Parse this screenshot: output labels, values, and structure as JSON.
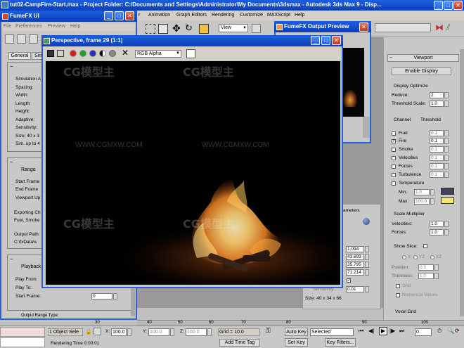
{
  "main_window": {
    "title": "tut02-CampFire-Start.max    - Project Folder: C:\\Documents and Settings\\Administrator\\My Documents\\3dsmax    - Autodesk 3ds Max 9    - Disp...",
    "menu": [
      "r",
      "Animation",
      "Graph Editors",
      "Rendering",
      "Customize",
      "MAXScript",
      "Help"
    ],
    "view_dropdown": "View"
  },
  "fumefx_ui": {
    "title": "FumeFX UI",
    "menu": [
      "File",
      "Preferences",
      "Preview",
      "Help"
    ],
    "tabs": [
      "General",
      "Sim"
    ],
    "sim_labels": [
      "Simulation A",
      "Spacing:",
      "Width:",
      "Length:",
      "Height:",
      "Adaptive:",
      "Sensitivity:",
      "Size: 40 x 3",
      "Sim. up to 4"
    ],
    "range_title": "Range",
    "range_labels": [
      "Start Frame",
      "End Frame",
      "Viewport Up"
    ],
    "exporting": [
      "Exporting Ch",
      "Fuel, Smoke"
    ],
    "output_label": "Output Path:",
    "output_path": "C:\\fxData\\s",
    "playback_title": "Playback",
    "playback_labels": [
      "Play From:",
      "Play To:",
      "Start Frame:"
    ],
    "start_frame_value": "0",
    "bottom_cut": "Output Range Type:"
  },
  "output_preview": {
    "title": "FumeFX Output Preview"
  },
  "render_window": {
    "title": "Perspective, frame 29 (1:1)",
    "channel_dropdown": "RGB Alpha",
    "watermark_text": "模型主",
    "watermark_logo": "CG",
    "watermark_url": "WWW.CGMXW.COM"
  },
  "middle_panel": {
    "params_label": "ameters",
    "values": [
      "1.094",
      "43.693",
      "35.795",
      "71.214"
    ],
    "sensitivity_label": "Sensitivity:",
    "sensitivity_value": "0.01",
    "size_label": "Size: 40 x 34 x 66"
  },
  "viewport_panel": {
    "title": "Viewport",
    "enable_display": "Enable Display",
    "display_optimize": "Display Optimize",
    "reduce_label": "Reduce:",
    "reduce_value": "2",
    "threshold_scale_label": "Threshold Scale:",
    "threshold_scale_value": "1.0",
    "channel_header": "Channel",
    "threshold_header": "Threshold",
    "channels": [
      {
        "name": "Fuel",
        "checked": false,
        "value": "0.1"
      },
      {
        "name": "Fire",
        "checked": true,
        "value": "0.1"
      },
      {
        "name": "Smoke",
        "checked": false,
        "value": "0.1"
      },
      {
        "name": "Velocities",
        "checked": false,
        "value": "0.1"
      },
      {
        "name": "Forces",
        "checked": false,
        "value": "0.1"
      },
      {
        "name": "Turbulence",
        "checked": false,
        "value": "0.1"
      },
      {
        "name": "Temperature",
        "checked": false,
        "value": ""
      }
    ],
    "min_label": "Min:",
    "min_value": "1.0",
    "max_label": "Max:",
    "max_value": "100.0",
    "min_color": "#4a3d5a",
    "max_color": "#f4e27a",
    "scale_multiplier": "Scale Multiplier",
    "velocities_label": "Velocities:",
    "velocities_value": "1.0",
    "forces_label": "Forces:",
    "forces_value": "1.0",
    "show_slice_label": "Show Slice:",
    "axis_options": [
      "X",
      "YZ",
      "XZ"
    ],
    "position_label": "Position:",
    "position_value": "0.0",
    "thickness_label": "Thickness:",
    "thickness_value": "1.0",
    "grid_label": "Grid",
    "numerical_values_label": "Numerical Values",
    "voxel_grid_label": "Voxel Grid"
  },
  "status_bar": {
    "object_selected": "1 Object Sele",
    "rendering_time": "Rendering Time  0:00:01",
    "x_label": "X:",
    "x_value": "100.0",
    "y_label": "Y:",
    "y_value": "100.0",
    "z_label": "Z:",
    "z_value": "100.0",
    "grid": "Grid = 10.0",
    "add_time_tag": "Add Time Tag",
    "auto_key": "Auto Key",
    "set_key": "Set Key",
    "selected": "Selected",
    "key_filters": "Key Filters...",
    "frame_value": "0",
    "ruler_ticks": [
      "30",
      "40",
      "50",
      "60",
      "70",
      "80",
      "90",
      "100"
    ]
  }
}
